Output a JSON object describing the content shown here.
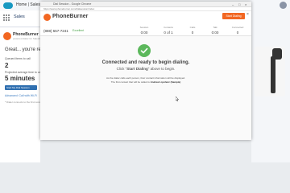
{
  "background": {
    "tab_label": "Home | Salesforce",
    "app_name": "Sales",
    "phoneburner_name": "PhoneBurner",
    "phoneburner_sub": "powered dialer for Salesforce",
    "greeting": "Great... you're ready",
    "queued_label": "Queued items to call",
    "queued_value": "2",
    "projected_label": "Projected average time to call",
    "projected_value": "5 minutes",
    "start_button": "Start My Dial Session",
    "link_text": "Advanced: Call with Wi-Fi",
    "note": "* Dialer connects to the first record"
  },
  "popup": {
    "window_title": "Dial Session - Google Chrome",
    "window_controls": {
      "minimize": "–",
      "maximize": "□",
      "close": "×"
    },
    "url": "https://www.phoneburner.com/dialsession/index",
    "app_title": "PhoneBurner",
    "start_dialing": "Start Dialing",
    "close_glyph": "×",
    "caller_number": "(888) 557-7241",
    "connection_quality": "Excellent",
    "stats": [
      {
        "label": "Session",
        "value": "0:00"
      },
      {
        "label": "Contacts",
        "value": "0 of 1"
      },
      {
        "label": "Calls",
        "value": "0"
      },
      {
        "label": "Talk",
        "value": "0:00"
      },
      {
        "label": "Connected",
        "value": "0"
      }
    ],
    "headline": "Connected and ready to begin dialing.",
    "subline_prefix": "Click \"",
    "subline_action": "Start Dialing",
    "subline_suffix": "\" above to begin.",
    "note_line1": "As the dialer calls each person, their contact information will be displayed.",
    "note_line2_prefix": "The first contact that will be called is ",
    "note_line2_contact": "Andrew Lipshutz (Sample)"
  },
  "colors": {
    "brand_orange": "#f26722",
    "success_green": "#5cb85c",
    "salesforce_blue": "#1798c1"
  }
}
